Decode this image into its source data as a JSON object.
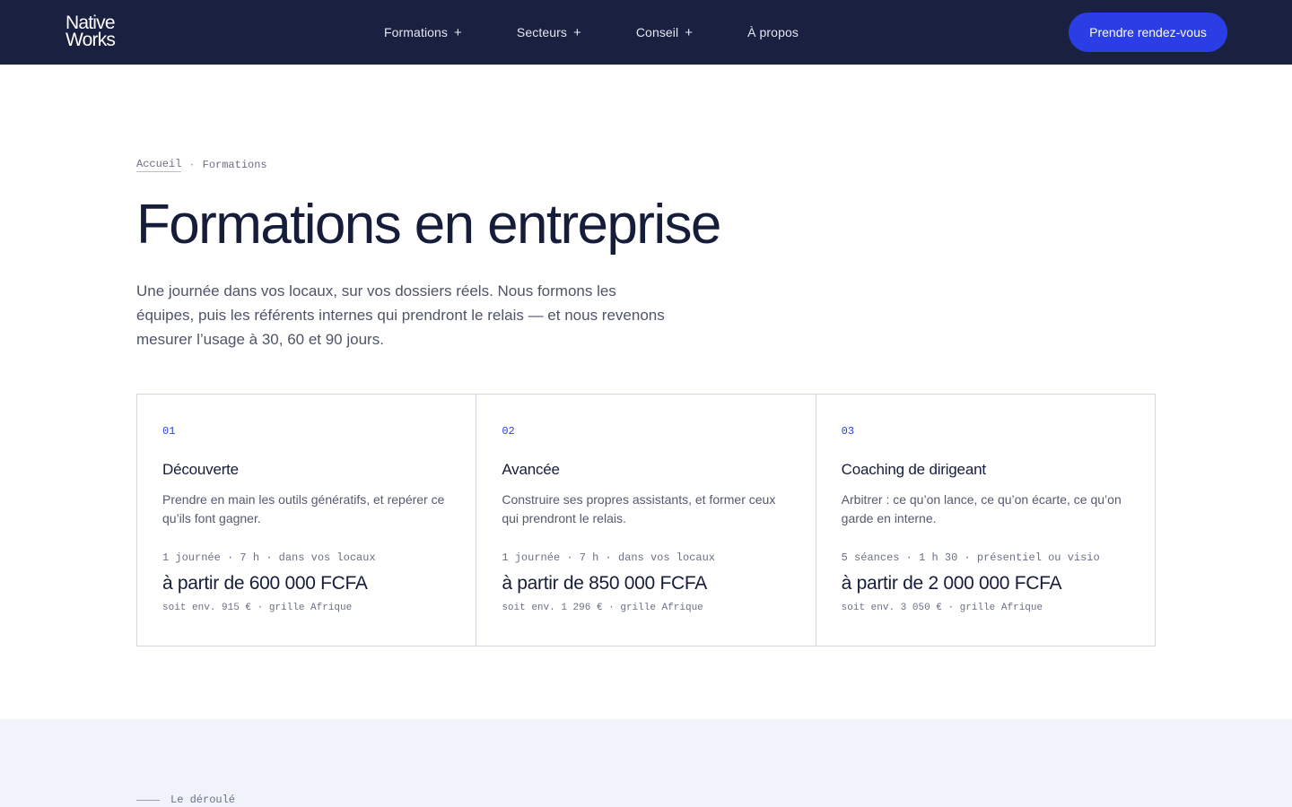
{
  "header": {
    "logo": {
      "line1": "Native",
      "line2": "Works"
    },
    "nav": [
      {
        "label": "Formations",
        "has_submenu": true,
        "marker": "+"
      },
      {
        "label": "Secteurs",
        "has_submenu": true,
        "marker": "+"
      },
      {
        "label": "Conseil",
        "has_submenu": true,
        "marker": "+"
      },
      {
        "label": "À propos",
        "has_submenu": false,
        "marker": ""
      }
    ],
    "cta_label": "Prendre rendez-vous"
  },
  "breadcrumb": {
    "home": "Accueil",
    "separator": "·",
    "current": "Formations"
  },
  "hero": {
    "title": "Formations en entreprise",
    "intro": "Une journée dans vos locaux, sur vos dossiers réels. Nous formons les équipes, puis les référents internes qui prendront le relais — et nous revenons mesurer l’usage à 30, 60 et 90 jours."
  },
  "offers": [
    {
      "number": "01",
      "title": "Découverte",
      "description": "Prendre en main les outils génératifs, et repérer ce qu’ils font gagner.",
      "meta": "1 journée · 7 h · dans vos locaux",
      "price": "à partir de 600 000 FCFA",
      "price_note": "soit env. 915 € · grille Afrique"
    },
    {
      "number": "02",
      "title": "Avancée",
      "description": "Construire ses propres assistants, et former ceux qui prendront le relais.",
      "meta": "1 journée · 7 h · dans vos locaux",
      "price": "à partir de 850 000 FCFA",
      "price_note": "soit env. 1 296 € · grille Afrique"
    },
    {
      "number": "03",
      "title": "Coaching de dirigeant",
      "description": "Arbitrer : ce qu’on lance, ce qu’on écarte, ce qu’on garde en interne.",
      "meta": "5 séances · 1 h 30 · présentiel ou visio",
      "price": "à partir de 2 000 000 FCFA",
      "price_note": "soit env. 3 050 € · grille Afrique"
    }
  ],
  "next_section": {
    "eyebrow": "Le déroulé"
  },
  "colors": {
    "header_bg": "#1a2040",
    "accent": "#2b3ee6",
    "text_dark": "#161d3a",
    "section_bg": "#f0f3fa"
  }
}
